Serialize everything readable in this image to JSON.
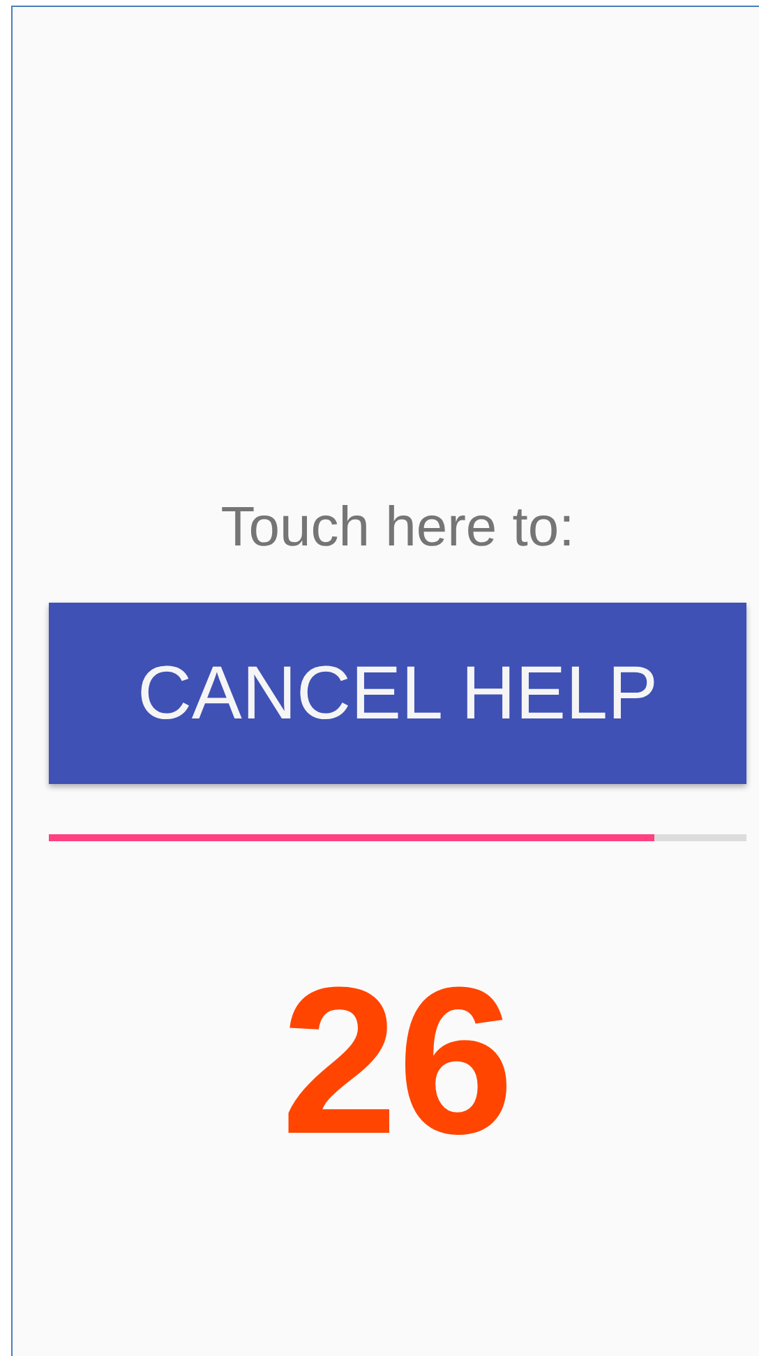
{
  "prompt": "Touch here to:",
  "button": {
    "label": "CANCEL HELP"
  },
  "progress": {
    "level": 0.868
  },
  "countdown": "26"
}
